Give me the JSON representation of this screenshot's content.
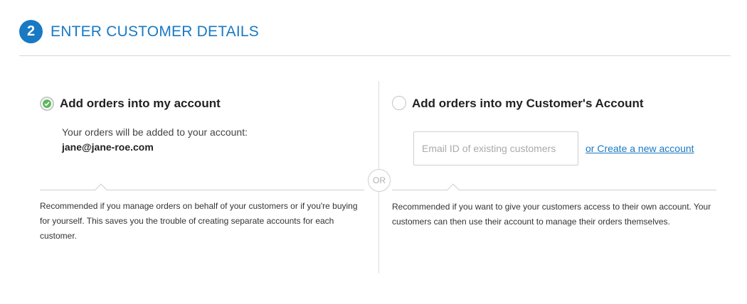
{
  "header": {
    "step_number": "2",
    "title": "ENTER CUSTOMER DETAILS"
  },
  "separator": {
    "or_label": "OR"
  },
  "option_own_account": {
    "title": "Add orders into my account",
    "selected": true,
    "info_text": "Your orders will be added to your account:",
    "email": "jane@jane-roe.com",
    "note": "Recommended if you manage orders on behalf of your customers or if you're buying for yourself. This saves you the trouble of creating separate accounts for each customer."
  },
  "option_customer_account": {
    "title": "Add orders into my Customer's Account",
    "selected": false,
    "email_input": {
      "value": "",
      "placeholder": "Email ID of existing customers"
    },
    "create_link": "or Create a new account",
    "note": "Recommended if you want to give your customers access to their own account. Your customers can then use their account to manage their orders themselves."
  },
  "colors": {
    "accent": "#1979c3",
    "check_green": "#5cb85c"
  }
}
